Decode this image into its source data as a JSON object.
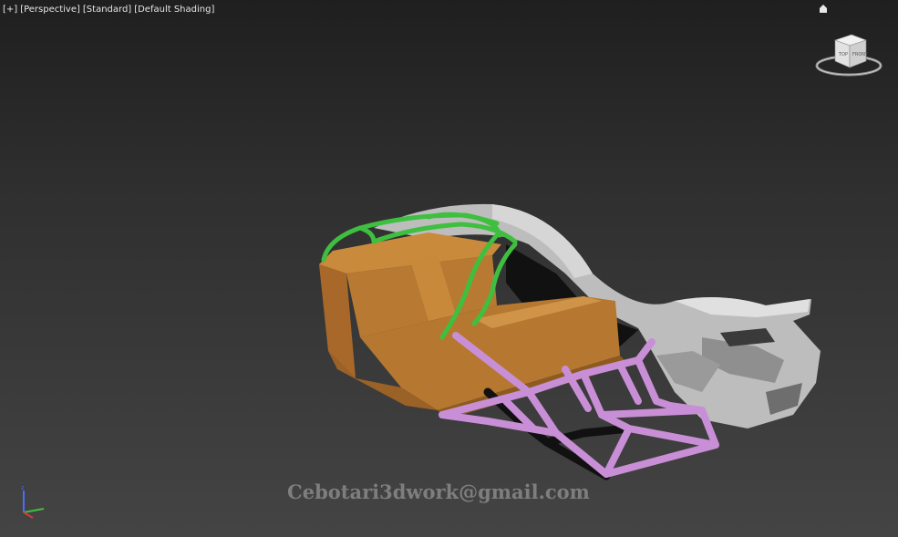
{
  "viewport": {
    "labels": {
      "plus": "[+]",
      "view": "[Perspective]",
      "style": "[Standard]",
      "shading": "[Default Shading]"
    }
  },
  "viewcube": {
    "faces": [
      "TOP",
      "FRONT"
    ],
    "icon": "viewcube-icon"
  },
  "icons": {
    "home": "home-icon",
    "axis": "axis-tripod-icon"
  },
  "watermark": "Cebotari3dwork@gmail.com",
  "colors": {
    "background_top": "#1f1f1f",
    "background_bottom": "#444444",
    "rollcage": "#3fbf3f",
    "seats": "#b8782e",
    "chassis_frame": "#c991d8",
    "body_shell": "#b9b9b9"
  }
}
